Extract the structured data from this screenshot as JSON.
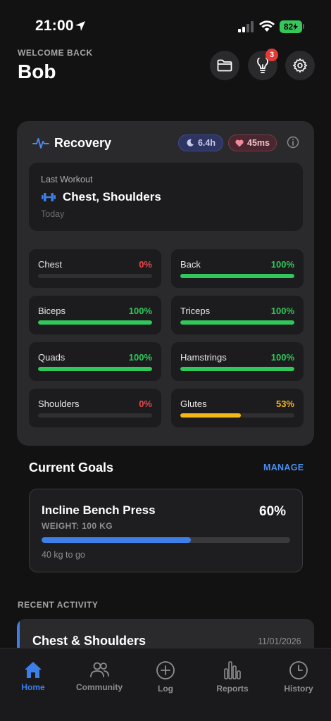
{
  "status_bar": {
    "time": "21:00",
    "battery": "82"
  },
  "header": {
    "welcome": "WELCOME BACK",
    "user_name": "Bob",
    "notification_count": "3"
  },
  "recovery": {
    "title": "Recovery",
    "sleep": "6.4h",
    "hrv": "45ms",
    "last_workout": {
      "label": "Last Workout",
      "title": "Chest, Shoulders",
      "date": "Today"
    },
    "muscles": [
      {
        "name": "Chest",
        "value": "0%",
        "percent": 0,
        "color": "#e5484d"
      },
      {
        "name": "Back",
        "value": "100%",
        "percent": 100,
        "color": "#30c85a"
      },
      {
        "name": "Biceps",
        "value": "100%",
        "percent": 100,
        "color": "#30c85a"
      },
      {
        "name": "Triceps",
        "value": "100%",
        "percent": 100,
        "color": "#30c85a"
      },
      {
        "name": "Quads",
        "value": "100%",
        "percent": 100,
        "color": "#30c85a"
      },
      {
        "name": "Hamstrings",
        "value": "100%",
        "percent": 100,
        "color": "#30c85a"
      },
      {
        "name": "Shoulders",
        "value": "0%",
        "percent": 0,
        "color": "#e5484d"
      },
      {
        "name": "Glutes",
        "value": "53%",
        "percent": 53,
        "color": "#f5b716"
      }
    ]
  },
  "goals": {
    "title": "Current Goals",
    "manage_label": "MANAGE",
    "items": [
      {
        "name": "Incline Bench Press",
        "percent_label": "60%",
        "percent": 60,
        "sub": "WEIGHT: 100 KG",
        "remaining": "40 kg to go"
      }
    ]
  },
  "recent": {
    "heading": "RECENT ACTIVITY",
    "items": [
      {
        "title": "Chest & Shoulders",
        "date": "11/01/2026"
      }
    ]
  },
  "tabs": [
    {
      "label": "Home",
      "icon": "home-icon",
      "active": true
    },
    {
      "label": "Community",
      "icon": "community-icon",
      "active": false
    },
    {
      "label": "Log",
      "icon": "plus-circle-icon",
      "active": false
    },
    {
      "label": "Reports",
      "icon": "bar-chart-icon",
      "active": false
    },
    {
      "label": "History",
      "icon": "clock-icon",
      "active": false
    }
  ],
  "colors": {
    "accent": "#3d7fe8",
    "success": "#30c85a",
    "danger": "#e5484d",
    "warning": "#f5b716"
  }
}
